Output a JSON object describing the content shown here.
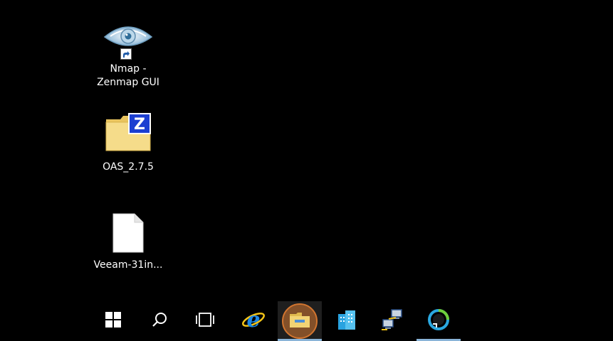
{
  "desktop": {
    "icons": [
      {
        "label_line1": "Nmap -",
        "label_line2": "Zenmap GUI",
        "icon": "eye-icon"
      },
      {
        "label_line1": "OAS_2.7.5",
        "icon": "zip-folder-icon",
        "badge": "Z"
      },
      {
        "label_line1": "Veeam-31in...",
        "icon": "blank-file-icon"
      }
    ]
  },
  "taskbar": {
    "buttons": [
      {
        "name": "start-button",
        "icon": "windows-logo-icon"
      },
      {
        "name": "search-button",
        "icon": "search-icon"
      },
      {
        "name": "task-view-button",
        "icon": "task-view-icon"
      },
      {
        "name": "internet-explorer-button",
        "icon": "internet-explorer-icon"
      },
      {
        "name": "file-explorer-button",
        "icon": "folder-icon",
        "highlighted": true
      },
      {
        "name": "server-manager-button",
        "icon": "server-manager-icon"
      },
      {
        "name": "network-app-button",
        "icon": "network-computers-icon"
      },
      {
        "name": "veeam-button",
        "icon": "veeam-icon"
      }
    ]
  },
  "colors": {
    "background": "#000000",
    "taskbar_active": "#1f1f1f",
    "running_indicator": "#8ab4d8",
    "click_highlight": "#d2752f",
    "windows_blue": "#1e88e5",
    "folder_yellow": "#f2d374"
  }
}
